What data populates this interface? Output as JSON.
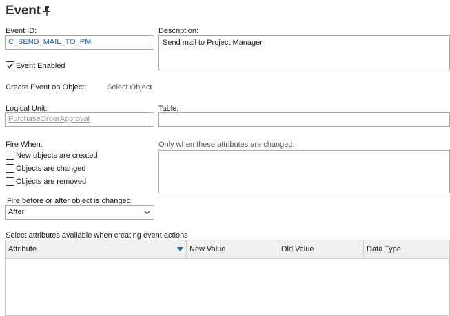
{
  "page": {
    "title": "Event",
    "pin_icon": "pin-icon"
  },
  "event_id": {
    "label": "Event ID:",
    "value": "C_SEND_MAIL_TO_PM"
  },
  "description": {
    "label": "Description:",
    "value": "Send mail to Project Manager"
  },
  "event_enabled": {
    "label": "Event Enabled",
    "checked": true
  },
  "create_event_on_object": {
    "label": "Create Event on Object:",
    "link": "Select Object"
  },
  "logical_unit": {
    "label": "Logical Unit:",
    "value": "PurchaseOrderApproval"
  },
  "table": {
    "label": "Table:",
    "value": ""
  },
  "fire_when": {
    "label": "Fire When:",
    "options": [
      {
        "label": "New objects are created",
        "checked": false
      },
      {
        "label": "Objects are changed",
        "checked": false
      },
      {
        "label": "Objects are removed",
        "checked": false
      }
    ]
  },
  "only_when": {
    "label": "Only when these attributes are changed:"
  },
  "fire_before_after": {
    "label": "Fire before or after object is changed:",
    "selected": "After"
  },
  "attributes_grid": {
    "label": "Select attributes available when creating event actions",
    "columns": [
      "Attribute",
      "New Value",
      "Old Value",
      "Data Type"
    ],
    "sort_icon": "sort-down-icon"
  }
}
